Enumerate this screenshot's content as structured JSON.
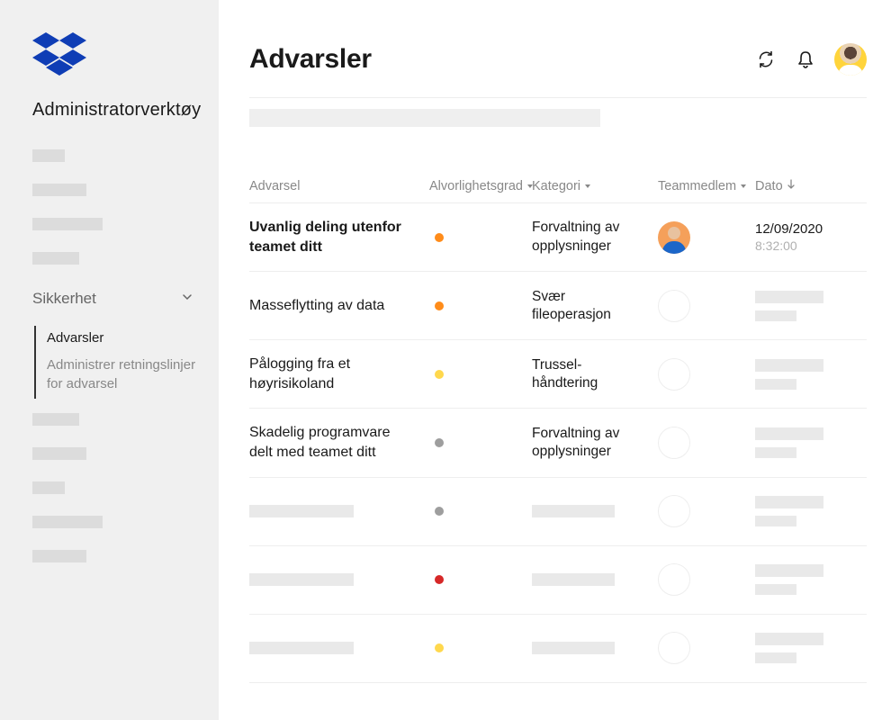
{
  "sidebar": {
    "product_title": "Administratorverktøy",
    "section_label": "Sikkerhet",
    "items": [
      {
        "label": "Advarsler",
        "active": true
      },
      {
        "label": "Administrer retningslinjer for advarsel",
        "active": false
      }
    ]
  },
  "header": {
    "title": "Advarsler"
  },
  "table": {
    "columns": {
      "alert": "Advarsel",
      "severity": "Alvorlighetsgrad",
      "category": "Kategori",
      "member": "Teammedlem",
      "date": "Dato"
    },
    "rows": [
      {
        "name": "Uvanlig deling utenfor teamet ditt",
        "bold": true,
        "severity_color": "#ff8c1a",
        "category": "Forvaltning av opplysninger",
        "member_has_avatar": true,
        "date": "12/09/2020",
        "time": "8:32:00"
      },
      {
        "name": "Masseflytting av data",
        "bold": false,
        "severity_color": "#ff8c1a",
        "category": "Svær fileoperasjon",
        "member_has_avatar": false
      },
      {
        "name": "Pålogging fra et høyrisikoland",
        "bold": false,
        "severity_color": "#ffd84d",
        "category": "Trussel- håndtering",
        "member_has_avatar": false
      },
      {
        "name": "Skadelig programvare delt med teamet ditt",
        "bold": false,
        "severity_color": "#9e9e9e",
        "category": "Forvaltning av opplysninger",
        "member_has_avatar": false
      },
      {
        "name": null,
        "severity_color": "#9e9e9e",
        "category": null,
        "member_has_avatar": false
      },
      {
        "name": null,
        "severity_color": "#d62828",
        "category": null,
        "member_has_avatar": false
      },
      {
        "name": null,
        "severity_color": "#ffd84d",
        "category": null,
        "member_has_avatar": false
      }
    ]
  }
}
